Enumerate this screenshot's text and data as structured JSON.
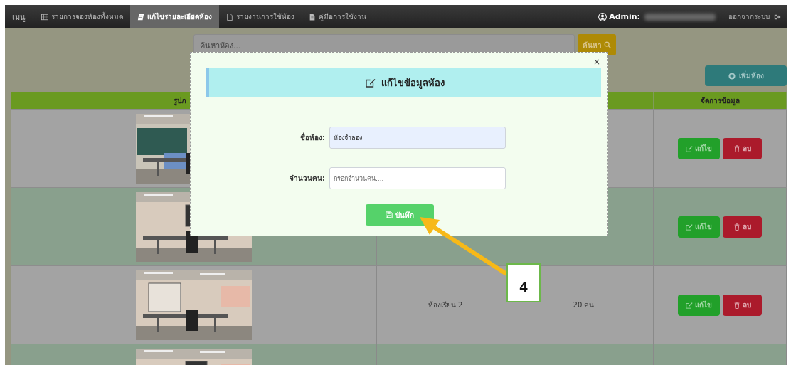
{
  "navbar": {
    "brand": "เมนู",
    "items": [
      {
        "label": "รายการจองห้องทั้งหมด",
        "selected": false
      },
      {
        "label": "แก้ไขรายละเอียดห้อง",
        "selected": true
      },
      {
        "label": "รายงานการใช้ห้อง",
        "selected": false
      },
      {
        "label": "คู่มือการใช้งาน",
        "selected": false
      }
    ],
    "admin_label": "Admin:",
    "logout": "ออกจากระบบ"
  },
  "search": {
    "placeholder": "ค้นหาห้อง...",
    "button": "ค้นหา"
  },
  "add_button": "เพิ่มห้อง",
  "table": {
    "header": {
      "column_1": "รูปภ",
      "column_4": "จัดการข้อมูล"
    },
    "rows": [
      {
        "kind": "picture",
        "actions": [
          "แก้ไข",
          "ลบ"
        ]
      },
      {
        "kind": "picture",
        "actions": [
          "แก้ไข",
          "ลบ"
        ]
      },
      {
        "kind": "picture",
        "name": "ห้องเรียน 2",
        "capacity": "20 คน",
        "actions": [
          "แก้ไข",
          "ลบ"
        ]
      },
      {
        "kind": "picture"
      }
    ]
  },
  "modal": {
    "title": "แก้ไขข้อมูลห้อง",
    "close": "×",
    "fields": [
      {
        "label": "ชื่อห้อง:",
        "value": "ห้องจำลอง"
      },
      {
        "label": "จำนวนคน:",
        "placeholder": "กรอกจำนวนคน...."
      }
    ],
    "save": "บันทึก"
  },
  "callout": {
    "label": "4"
  }
}
